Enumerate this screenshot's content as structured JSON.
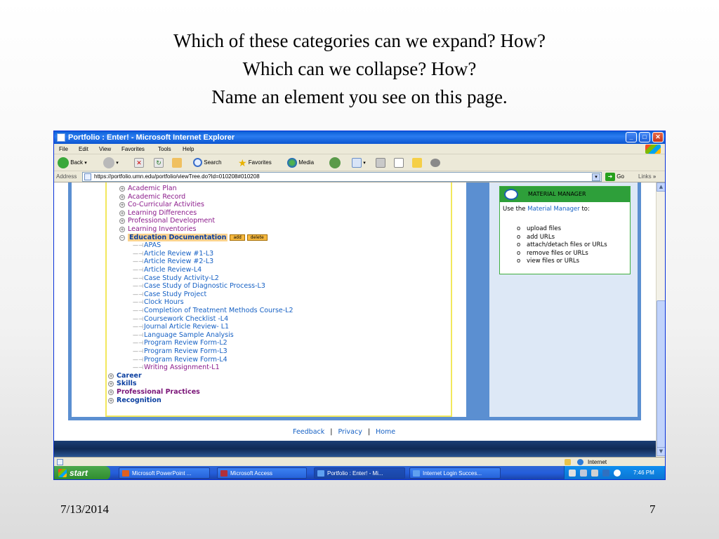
{
  "slide": {
    "title_lines": [
      "Which of these categories can we expand?  How?",
      "Which can we collapse?  How?",
      "Name an element you see on this page."
    ],
    "date": "7/13/2014",
    "number": "7"
  },
  "window": {
    "title": "Portfolio : Enter! - Microsoft Internet Explorer",
    "controls": {
      "minimize": "_",
      "maximize": "□",
      "close": "✕"
    }
  },
  "menu": [
    "File",
    "Edit",
    "View",
    "Favorites",
    "Tools",
    "Help"
  ],
  "toolbar": {
    "back": "Back",
    "search": "Search",
    "favorites": "Favorites",
    "media": "Media"
  },
  "address": {
    "label": "Address",
    "url": "https://portfolio.umn.edu/portfolio/viewTree.do?Id=010208#010208",
    "go": "Go",
    "links": "Links"
  },
  "tree": {
    "top_items": [
      "Academic Plan",
      "Academic Record",
      "Co-Curricular Activities",
      "Learning Differences",
      "Professional Development",
      "Learning Inventories"
    ],
    "expanded": {
      "label": "Education Documentation",
      "add": "add",
      "delete": "delete",
      "children": [
        "APAS",
        "Article Review #1-L3",
        "Article Review #2-L3",
        "Article Review-L4",
        "Case Study Activity-L2",
        "Case Study of Diagnostic Process-L3",
        "Case Study Project",
        "Clock Hours",
        "Completion of Treatment Methods Course-L2",
        "Coursework Checklist -L4",
        "Journal Article Review- L1",
        "Language Sample Analysis",
        "Program Review Form-L2",
        "Program Review Form-L3",
        "Program Review Form-L4",
        "Writing Assignment-L1"
      ]
    },
    "bottom_items": [
      "Career",
      "Skills",
      "Professional Practices",
      "Recognition"
    ]
  },
  "material_manager": {
    "title": "MATERIAL MANAGER",
    "intro_prefix": "Use the",
    "intro_link": "Material Manager",
    "intro_suffix": "to:",
    "items": [
      "upload files",
      "add URLs",
      "attach/detach files or URLs",
      "remove files or URLs",
      "view files or URLs"
    ],
    "bullet": "o"
  },
  "footer": {
    "feedback": "Feedback",
    "privacy": "Privacy",
    "home": "Home",
    "separator": "|"
  },
  "status": {
    "zone": "Internet"
  },
  "taskbar": {
    "start": "start",
    "tasks": [
      "Microsoft PowerPoint ...",
      "Microsoft Access",
      "Portfolio : Enter! - Mi...",
      "Internet Login Succes..."
    ],
    "clock": "7:46 PM"
  },
  "colors": {
    "title_bar": "#0a5fd6",
    "tree_link": "#1560c4",
    "visited_link": "#8b1a8b",
    "accent_green": "#2e9f3a",
    "highlight": "#fcd38e"
  }
}
